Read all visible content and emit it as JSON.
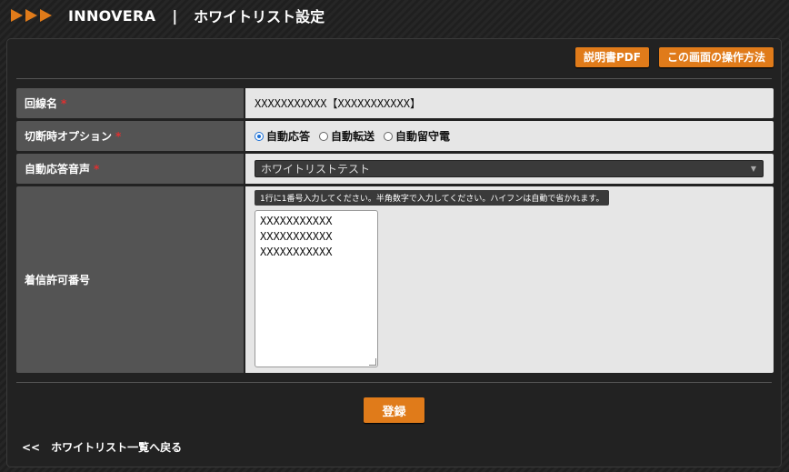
{
  "header": {
    "brand": "INNOVERA",
    "separator": "|",
    "title": "ホワイトリスト設定"
  },
  "toolbar": {
    "manual_pdf_label": "説明書PDF",
    "howto_label": "この画面の操作方法"
  },
  "form": {
    "line_name": {
      "label": "回線名",
      "required": "*",
      "value": "XXXXXXXXXXX【XXXXXXXXXXX】"
    },
    "disconnect_option": {
      "label": "切断時オプション",
      "required": "*",
      "options": [
        {
          "label": "自動応答",
          "selected": true
        },
        {
          "label": "自動転送",
          "selected": false
        },
        {
          "label": "自動留守電",
          "selected": false
        }
      ]
    },
    "auto_response_voice": {
      "label": "自動応答音声",
      "required": "*",
      "selected": "ホワイトリストテスト"
    },
    "allowed_numbers": {
      "label": "着信許可番号",
      "hint": "1行に1番号入力してください。半角数字で入力してください。ハイフンは自動で省かれます。",
      "lines": [
        "XXXXXXXXXXX",
        "XXXXXXXXXXX",
        "XXXXXXXXXXX"
      ]
    }
  },
  "actions": {
    "register_label": "登録",
    "back_link": "<<　ホワイトリスト一覧へ戻る"
  },
  "colors": {
    "accent": "#e07b1a",
    "label_bg": "#545454",
    "value_bg": "#e6e6e6",
    "required": "#e03030"
  }
}
